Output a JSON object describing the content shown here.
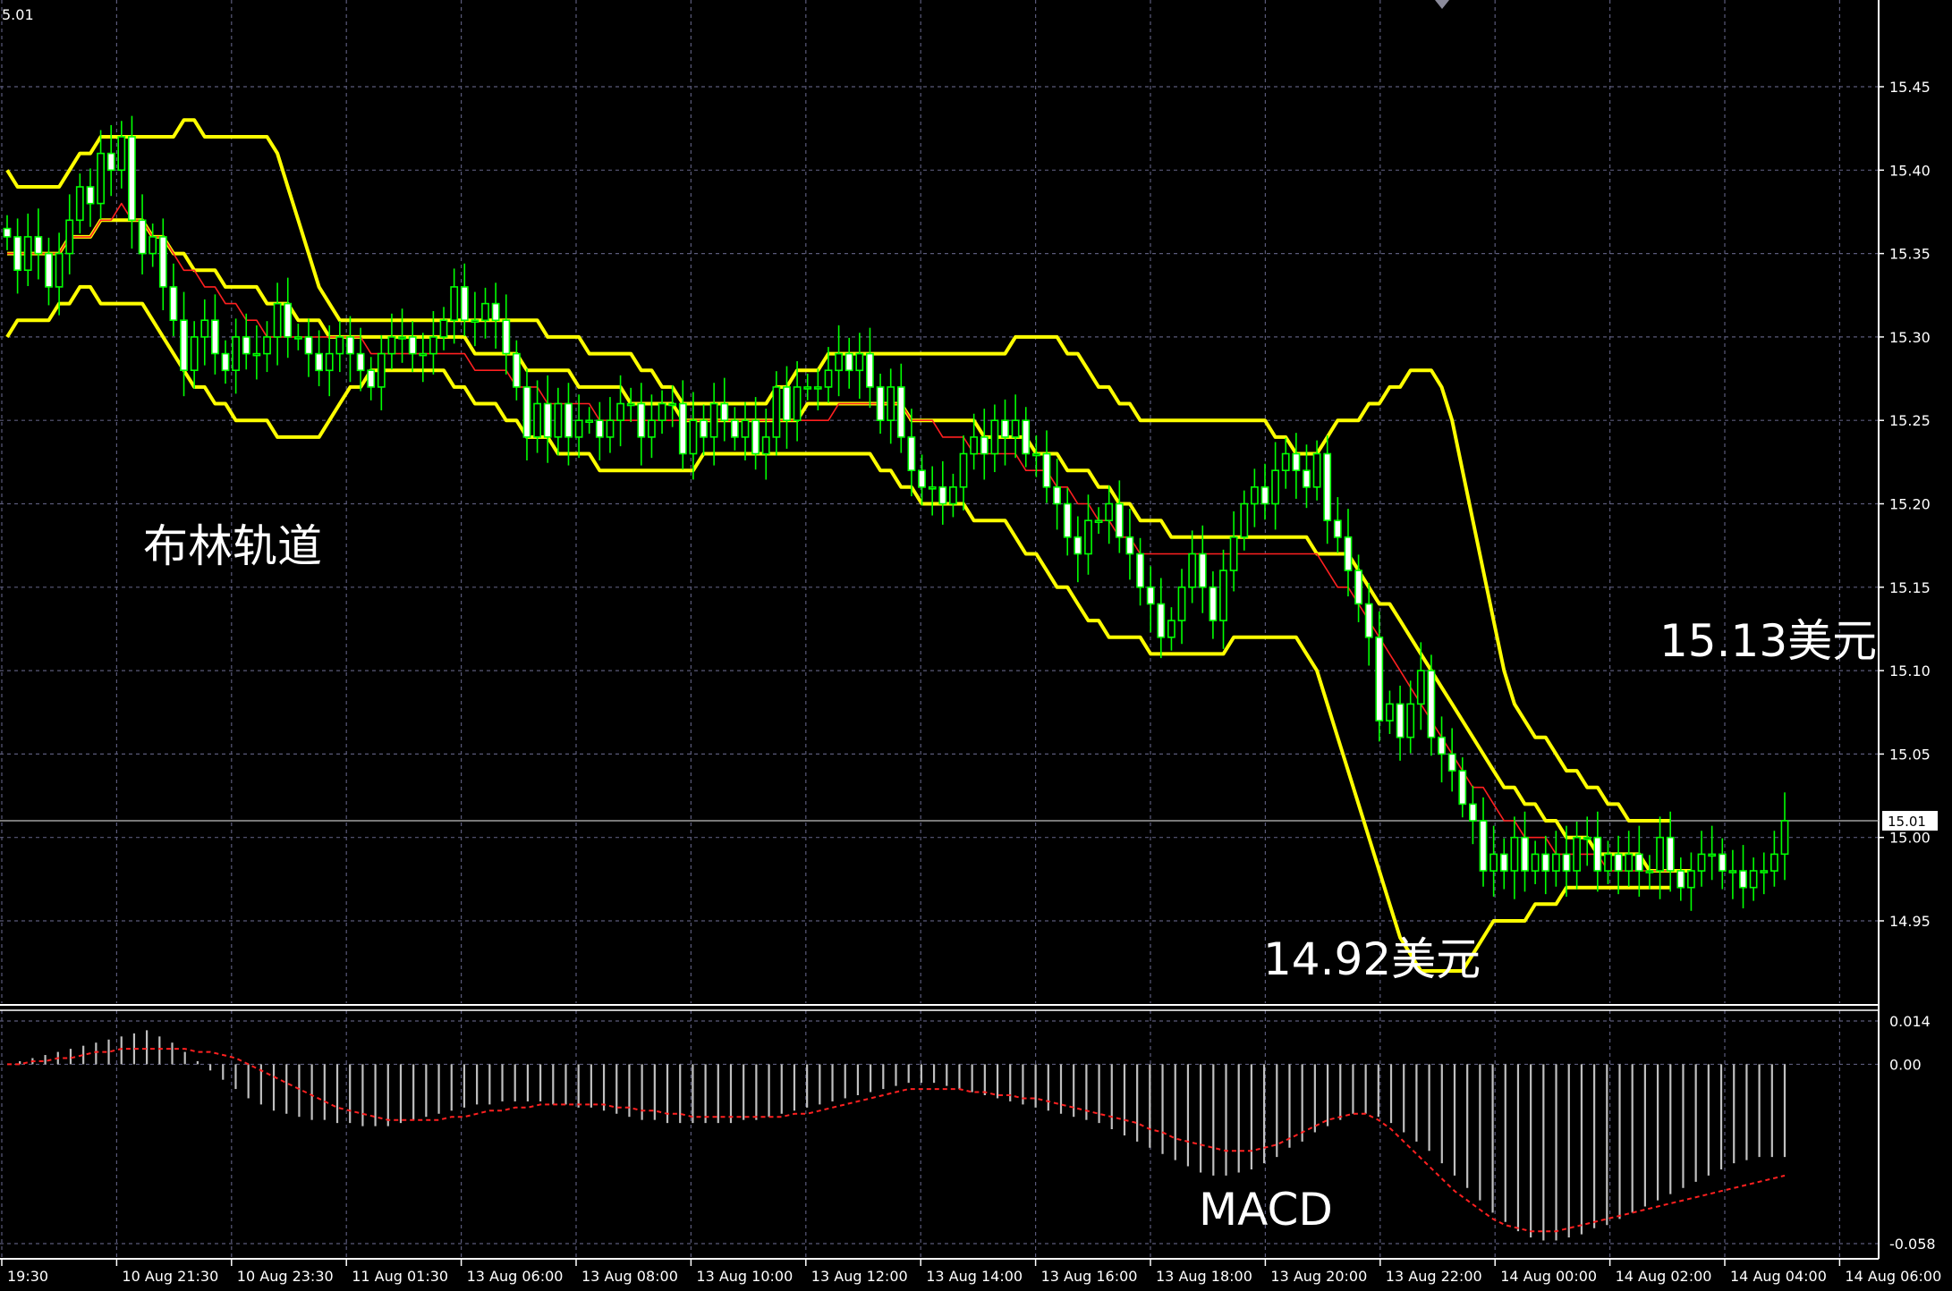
{
  "chart_data": {
    "type": "candlestick",
    "corner_label": "5.01",
    "current_price_tag": "15.01",
    "current_price": 15.01,
    "price_axis": {
      "ylim": [
        14.9,
        15.5
      ],
      "ticks": [
        "15.45",
        "15.40",
        "15.35",
        "15.30",
        "15.25",
        "15.20",
        "15.15",
        "15.10",
        "15.05",
        "15.00",
        "14.95"
      ],
      "tick_values": [
        15.45,
        15.4,
        15.35,
        15.3,
        15.25,
        15.2,
        15.15,
        15.1,
        15.05,
        15.0,
        14.95
      ]
    },
    "macd_axis": {
      "ylim": [
        -0.062,
        0.018
      ],
      "ticks": [
        "0.014",
        "0.00",
        "-0.058"
      ],
      "tick_values": [
        0.014,
        0.0,
        -0.058
      ]
    },
    "x_labels": [
      "19:30",
      "10 Aug 21:30",
      "10 Aug 23:30",
      "11 Aug 01:30",
      "13 Aug 06:00",
      "13 Aug 08:00",
      "13 Aug 10:00",
      "13 Aug 12:00",
      "13 Aug 14:00",
      "13 Aug 16:00",
      "13 Aug 18:00",
      "13 Aug 20:00",
      "13 Aug 22:00",
      "14 Aug 00:00",
      "14 Aug 02:00",
      "14 Aug 04:00",
      "14 Aug 06:00"
    ],
    "close": [
      15.36,
      15.34,
      15.36,
      15.35,
      15.33,
      15.35,
      15.37,
      15.39,
      15.38,
      15.41,
      15.4,
      15.42,
      15.37,
      15.35,
      15.36,
      15.33,
      15.31,
      15.28,
      15.3,
      15.31,
      15.29,
      15.28,
      15.3,
      15.29,
      15.29,
      15.3,
      15.32,
      15.3,
      15.3,
      15.29,
      15.28,
      15.29,
      15.3,
      15.29,
      15.28,
      15.27,
      15.29,
      15.3,
      15.3,
      15.29,
      15.29,
      15.3,
      15.31,
      15.33,
      15.31,
      15.31,
      15.32,
      15.31,
      15.29,
      15.27,
      15.24,
      15.26,
      15.24,
      15.26,
      15.24,
      15.25,
      15.25,
      15.24,
      15.25,
      15.26,
      15.26,
      15.24,
      15.25,
      15.26,
      15.26,
      15.23,
      15.25,
      15.24,
      15.26,
      15.25,
      15.24,
      15.25,
      15.23,
      15.24,
      15.27,
      15.25,
      15.27,
      15.27,
      15.27,
      15.28,
      15.29,
      15.28,
      15.29,
      15.27,
      15.25,
      15.27,
      15.24,
      15.22,
      15.21,
      15.21,
      15.2,
      15.21,
      15.23,
      15.24,
      15.23,
      15.25,
      15.24,
      15.25,
      15.23,
      15.23,
      15.21,
      15.2,
      15.18,
      15.17,
      15.19,
      15.19,
      15.2,
      15.18,
      15.17,
      15.15,
      15.14,
      15.12,
      15.13,
      15.15,
      15.17,
      15.15,
      15.13,
      15.16,
      15.18,
      15.2,
      15.21,
      15.2,
      15.22,
      15.23,
      15.22,
      15.21,
      15.23,
      15.19,
      15.18,
      15.16,
      15.14,
      15.12,
      15.07,
      15.08,
      15.06,
      15.08,
      15.1,
      15.06,
      15.05,
      15.04,
      15.02,
      15.01,
      14.98,
      14.99,
      14.98,
      15.0,
      14.98,
      14.99,
      14.98,
      14.99,
      14.98,
      15.0,
      15.0,
      14.98,
      14.99,
      14.98,
      14.99,
      14.98,
      14.98,
      15.0,
      14.98,
      14.97,
      14.98,
      14.99,
      14.99,
      14.98,
      14.98,
      14.97,
      14.98,
      14.98,
      14.99,
      15.01
    ],
    "overlays": [
      {
        "name": "BB upper",
        "color": "#ffff00",
        "values": [
          15.4,
          15.39,
          15.39,
          15.39,
          15.39,
          15.39,
          15.4,
          15.41,
          15.41,
          15.42,
          15.42,
          15.42,
          15.42,
          15.42,
          15.42,
          15.42,
          15.42,
          15.43,
          15.43,
          15.42,
          15.42,
          15.42,
          15.42,
          15.42,
          15.42,
          15.42,
          15.41,
          15.39,
          15.37,
          15.35,
          15.33,
          15.32,
          15.31,
          15.31,
          15.31,
          15.31,
          15.31,
          15.31,
          15.31,
          15.31,
          15.31,
          15.31,
          15.31,
          15.31,
          15.31,
          15.31,
          15.31,
          15.31,
          15.31,
          15.31,
          15.31,
          15.31,
          15.3,
          15.3,
          15.3,
          15.3,
          15.29,
          15.29,
          15.29,
          15.29,
          15.29,
          15.28,
          15.28,
          15.27,
          15.27,
          15.26,
          15.26,
          15.26,
          15.26,
          15.26,
          15.26,
          15.26,
          15.26,
          15.26,
          15.27,
          15.27,
          15.28,
          15.28,
          15.28,
          15.29,
          15.29,
          15.29,
          15.29,
          15.29,
          15.29,
          15.29,
          15.29,
          15.29,
          15.29,
          15.29,
          15.29,
          15.29,
          15.29,
          15.29,
          15.29,
          15.29,
          15.29,
          15.3,
          15.3,
          15.3,
          15.3,
          15.3,
          15.29,
          15.29,
          15.28,
          15.27,
          15.27,
          15.26,
          15.26,
          15.25,
          15.25,
          15.25,
          15.25,
          15.25,
          15.25,
          15.25,
          15.25,
          15.25,
          15.25,
          15.25,
          15.25,
          15.25,
          15.24,
          15.24,
          15.23,
          15.23,
          15.23,
          15.24,
          15.25,
          15.25,
          15.25,
          15.26,
          15.26,
          15.27,
          15.27,
          15.28,
          15.28,
          15.28,
          15.27,
          15.25,
          15.22,
          15.19,
          15.16,
          15.13,
          15.1,
          15.08,
          15.07,
          15.06,
          15.06,
          15.05,
          15.04,
          15.04,
          15.03,
          15.03,
          15.02,
          15.02,
          15.01,
          15.01,
          15.01,
          15.01,
          15.01
        ]
      },
      {
        "name": "BB middle",
        "color": "#ffff00",
        "values": [
          15.35,
          15.35,
          15.35,
          15.35,
          15.35,
          15.35,
          15.36,
          15.36,
          15.36,
          15.37,
          15.37,
          15.37,
          15.37,
          15.37,
          15.36,
          15.36,
          15.35,
          15.35,
          15.34,
          15.34,
          15.34,
          15.33,
          15.33,
          15.33,
          15.33,
          15.32,
          15.32,
          15.32,
          15.31,
          15.31,
          15.31,
          15.3,
          15.3,
          15.3,
          15.3,
          15.3,
          15.3,
          15.3,
          15.3,
          15.3,
          15.3,
          15.3,
          15.3,
          15.3,
          15.3,
          15.29,
          15.29,
          15.29,
          15.29,
          15.29,
          15.28,
          15.28,
          15.28,
          15.28,
          15.28,
          15.27,
          15.27,
          15.27,
          15.27,
          15.27,
          15.26,
          15.26,
          15.26,
          15.26,
          15.26,
          15.25,
          15.25,
          15.25,
          15.25,
          15.25,
          15.25,
          15.25,
          15.25,
          15.25,
          15.25,
          15.25,
          15.25,
          15.26,
          15.26,
          15.26,
          15.26,
          15.26,
          15.26,
          15.26,
          15.26,
          15.26,
          15.26,
          15.25,
          15.25,
          15.25,
          15.25,
          15.25,
          15.25,
          15.25,
          15.24,
          15.24,
          15.24,
          15.24,
          15.24,
          15.23,
          15.23,
          15.23,
          15.22,
          15.22,
          15.22,
          15.21,
          15.21,
          15.2,
          15.2,
          15.19,
          15.19,
          15.19,
          15.18,
          15.18,
          15.18,
          15.18,
          15.18,
          15.18,
          15.18,
          15.18,
          15.18,
          15.18,
          15.18,
          15.18,
          15.18,
          15.18,
          15.17,
          15.17,
          15.17,
          15.17,
          15.16,
          15.15,
          15.14,
          15.14,
          15.13,
          15.12,
          15.11,
          15.1,
          15.09,
          15.08,
          15.07,
          15.06,
          15.05,
          15.04,
          15.03,
          15.03,
          15.02,
          15.02,
          15.01,
          15.01,
          15.0,
          15.0,
          15.0,
          14.99,
          14.99,
          14.99,
          14.99,
          14.99,
          14.98,
          14.98,
          14.98,
          14.98,
          14.98
        ]
      },
      {
        "name": "BB lower",
        "color": "#ffff00",
        "values": [
          15.3,
          15.31,
          15.31,
          15.31,
          15.31,
          15.32,
          15.32,
          15.33,
          15.33,
          15.32,
          15.32,
          15.32,
          15.32,
          15.32,
          15.31,
          15.3,
          15.29,
          15.28,
          15.27,
          15.27,
          15.26,
          15.26,
          15.25,
          15.25,
          15.25,
          15.25,
          15.24,
          15.24,
          15.24,
          15.24,
          15.24,
          15.25,
          15.26,
          15.27,
          15.27,
          15.28,
          15.28,
          15.28,
          15.28,
          15.28,
          15.28,
          15.28,
          15.28,
          15.27,
          15.27,
          15.26,
          15.26,
          15.26,
          15.25,
          15.25,
          15.24,
          15.24,
          15.24,
          15.23,
          15.23,
          15.23,
          15.23,
          15.22,
          15.22,
          15.22,
          15.22,
          15.22,
          15.22,
          15.22,
          15.22,
          15.22,
          15.22,
          15.23,
          15.23,
          15.23,
          15.23,
          15.23,
          15.23,
          15.23,
          15.23,
          15.23,
          15.23,
          15.23,
          15.23,
          15.23,
          15.23,
          15.23,
          15.23,
          15.23,
          15.22,
          15.22,
          15.21,
          15.21,
          15.2,
          15.2,
          15.2,
          15.2,
          15.2,
          15.19,
          15.19,
          15.19,
          15.19,
          15.18,
          15.17,
          15.17,
          15.16,
          15.15,
          15.15,
          15.14,
          15.13,
          15.13,
          15.12,
          15.12,
          15.12,
          15.12,
          15.11,
          15.11,
          15.11,
          15.11,
          15.11,
          15.11,
          15.11,
          15.11,
          15.12,
          15.12,
          15.12,
          15.12,
          15.12,
          15.12,
          15.12,
          15.11,
          15.1,
          15.08,
          15.06,
          15.04,
          15.02,
          15.0,
          14.98,
          14.96,
          14.94,
          14.93,
          14.92,
          14.92,
          14.92,
          14.92,
          14.92,
          14.93,
          14.94,
          14.95,
          14.95,
          14.95,
          14.95,
          14.96,
          14.96,
          14.96,
          14.97,
          14.97,
          14.97,
          14.97,
          14.97,
          14.97,
          14.97,
          14.97,
          14.97,
          14.97,
          14.97
        ]
      },
      {
        "name": "MA",
        "color": "#ff2020",
        "values": [
          15.35,
          15.35,
          15.35,
          15.35,
          15.35,
          15.35,
          15.36,
          15.36,
          15.36,
          15.37,
          15.37,
          15.38,
          15.37,
          15.37,
          15.36,
          15.36,
          15.35,
          15.34,
          15.34,
          15.33,
          15.33,
          15.32,
          15.32,
          15.31,
          15.31,
          15.3,
          15.3,
          15.3,
          15.3,
          15.3,
          15.3,
          15.3,
          15.3,
          15.3,
          15.3,
          15.29,
          15.29,
          15.29,
          15.29,
          15.29,
          15.29,
          15.29,
          15.29,
          15.29,
          15.29,
          15.28,
          15.28,
          15.28,
          15.28,
          15.27,
          15.27,
          15.27,
          15.26,
          15.26,
          15.26,
          15.26,
          15.26,
          15.25,
          15.25,
          15.25,
          15.25,
          15.25,
          15.25,
          15.25,
          15.25,
          15.25,
          15.25,
          15.25,
          15.25,
          15.25,
          15.25,
          15.25,
          15.25,
          15.25,
          15.25,
          15.25,
          15.25,
          15.25,
          15.25,
          15.25,
          15.26,
          15.26,
          15.26,
          15.26,
          15.26,
          15.26,
          15.26,
          15.25,
          15.25,
          15.25,
          15.24,
          15.24,
          15.24,
          15.23,
          15.23,
          15.23,
          15.23,
          15.23,
          15.22,
          15.22,
          15.22,
          15.21,
          15.21,
          15.2,
          15.2,
          15.19,
          15.19,
          15.18,
          15.18,
          15.17,
          15.17,
          15.17,
          15.17,
          15.17,
          15.17,
          15.17,
          15.17,
          15.17,
          15.17,
          15.17,
          15.17,
          15.17,
          15.17,
          15.17,
          15.17,
          15.17,
          15.17,
          15.16,
          15.15,
          15.15,
          15.14,
          15.13,
          15.12,
          15.11,
          15.1,
          15.09,
          15.08,
          15.07,
          15.06,
          15.05,
          15.04,
          15.03,
          15.03,
          15.02,
          15.01,
          15.01,
          15.0,
          15.0,
          15.0,
          14.99,
          14.99,
          14.99,
          14.99,
          14.99,
          14.98,
          14.98,
          14.98,
          14.98,
          14.98,
          14.98,
          14.98
        ]
      }
    ],
    "macd": {
      "histogram": [
        0.0,
        0.001,
        0.002,
        0.003,
        0.004,
        0.005,
        0.006,
        0.007,
        0.008,
        0.009,
        0.01,
        0.011,
        0.009,
        0.007,
        0.004,
        0.001,
        -0.002,
        -0.005,
        -0.008,
        -0.011,
        -0.013,
        -0.015,
        -0.016,
        -0.017,
        -0.018,
        -0.018,
        -0.019,
        -0.019,
        -0.02,
        -0.02,
        -0.02,
        -0.019,
        -0.018,
        -0.017,
        -0.016,
        -0.015,
        -0.014,
        -0.013,
        -0.013,
        -0.012,
        -0.012,
        -0.012,
        -0.012,
        -0.013,
        -0.013,
        -0.014,
        -0.014,
        -0.015,
        -0.016,
        -0.017,
        -0.018,
        -0.018,
        -0.019,
        -0.019,
        -0.019,
        -0.019,
        -0.019,
        -0.019,
        -0.018,
        -0.018,
        -0.017,
        -0.016,
        -0.015,
        -0.014,
        -0.013,
        -0.012,
        -0.011,
        -0.01,
        -0.009,
        -0.008,
        -0.007,
        -0.006,
        -0.006,
        -0.006,
        -0.007,
        -0.008,
        -0.009,
        -0.01,
        -0.011,
        -0.012,
        -0.013,
        -0.014,
        -0.015,
        -0.016,
        -0.017,
        -0.018,
        -0.019,
        -0.021,
        -0.023,
        -0.025,
        -0.027,
        -0.029,
        -0.031,
        -0.033,
        -0.035,
        -0.036,
        -0.036,
        -0.035,
        -0.034,
        -0.032,
        -0.03,
        -0.027,
        -0.025,
        -0.022,
        -0.02,
        -0.018,
        -0.016,
        -0.016,
        -0.017,
        -0.019,
        -0.022,
        -0.025,
        -0.028,
        -0.032,
        -0.036,
        -0.04,
        -0.044,
        -0.048,
        -0.051,
        -0.054,
        -0.056,
        -0.057,
        -0.057,
        -0.056,
        -0.055,
        -0.053,
        -0.052,
        -0.05,
        -0.048,
        -0.046,
        -0.044,
        -0.042,
        -0.04,
        -0.038,
        -0.036,
        -0.034,
        -0.032,
        -0.031,
        -0.03,
        -0.03,
        -0.03
      ],
      "signal": [
        0.0,
        0.0,
        0.001,
        0.001,
        0.002,
        0.002,
        0.003,
        0.004,
        0.004,
        0.005,
        0.005,
        0.005,
        0.005,
        0.005,
        0.005,
        0.004,
        0.004,
        0.003,
        0.002,
        0.0,
        -0.002,
        -0.004,
        -0.006,
        -0.008,
        -0.01,
        -0.012,
        -0.014,
        -0.015,
        -0.016,
        -0.017,
        -0.018,
        -0.018,
        -0.018,
        -0.018,
        -0.018,
        -0.017,
        -0.017,
        -0.016,
        -0.015,
        -0.015,
        -0.014,
        -0.014,
        -0.013,
        -0.013,
        -0.013,
        -0.013,
        -0.013,
        -0.013,
        -0.014,
        -0.014,
        -0.015,
        -0.015,
        -0.016,
        -0.016,
        -0.017,
        -0.017,
        -0.017,
        -0.017,
        -0.017,
        -0.017,
        -0.017,
        -0.017,
        -0.016,
        -0.016,
        -0.015,
        -0.014,
        -0.013,
        -0.012,
        -0.011,
        -0.01,
        -0.009,
        -0.008,
        -0.008,
        -0.008,
        -0.008,
        -0.008,
        -0.009,
        -0.009,
        -0.01,
        -0.01,
        -0.011,
        -0.011,
        -0.012,
        -0.013,
        -0.014,
        -0.015,
        -0.016,
        -0.017,
        -0.018,
        -0.019,
        -0.021,
        -0.022,
        -0.024,
        -0.025,
        -0.026,
        -0.027,
        -0.028,
        -0.028,
        -0.028,
        -0.027,
        -0.026,
        -0.024,
        -0.022,
        -0.02,
        -0.018,
        -0.017,
        -0.016,
        -0.016,
        -0.018,
        -0.021,
        -0.025,
        -0.029,
        -0.033,
        -0.037,
        -0.041,
        -0.044,
        -0.047,
        -0.05,
        -0.052,
        -0.053,
        -0.054,
        -0.054,
        -0.054,
        -0.053,
        -0.052,
        -0.051,
        -0.05,
        -0.049,
        -0.048,
        -0.047,
        -0.046,
        -0.045,
        -0.044,
        -0.043,
        -0.042,
        -0.041,
        -0.04,
        -0.039,
        -0.038,
        -0.037,
        -0.036
      ]
    },
    "annotations": {
      "bollinger": "布林轨道",
      "upper_price": "15.13美元",
      "lower_price": "14.92美元",
      "macd": "MACD"
    },
    "colors": {
      "background": "#000000",
      "grid": "#5a5a7a",
      "bull_fill": "#000000",
      "bear_fill": "#ffffff",
      "candle_outline": "#00ff00",
      "bollinger": "#ffff00",
      "moving_average": "#ff2020",
      "macd_histogram": "#c0c0c0",
      "macd_signal": "#ff2020",
      "current_line": "#a0a0a0"
    }
  }
}
